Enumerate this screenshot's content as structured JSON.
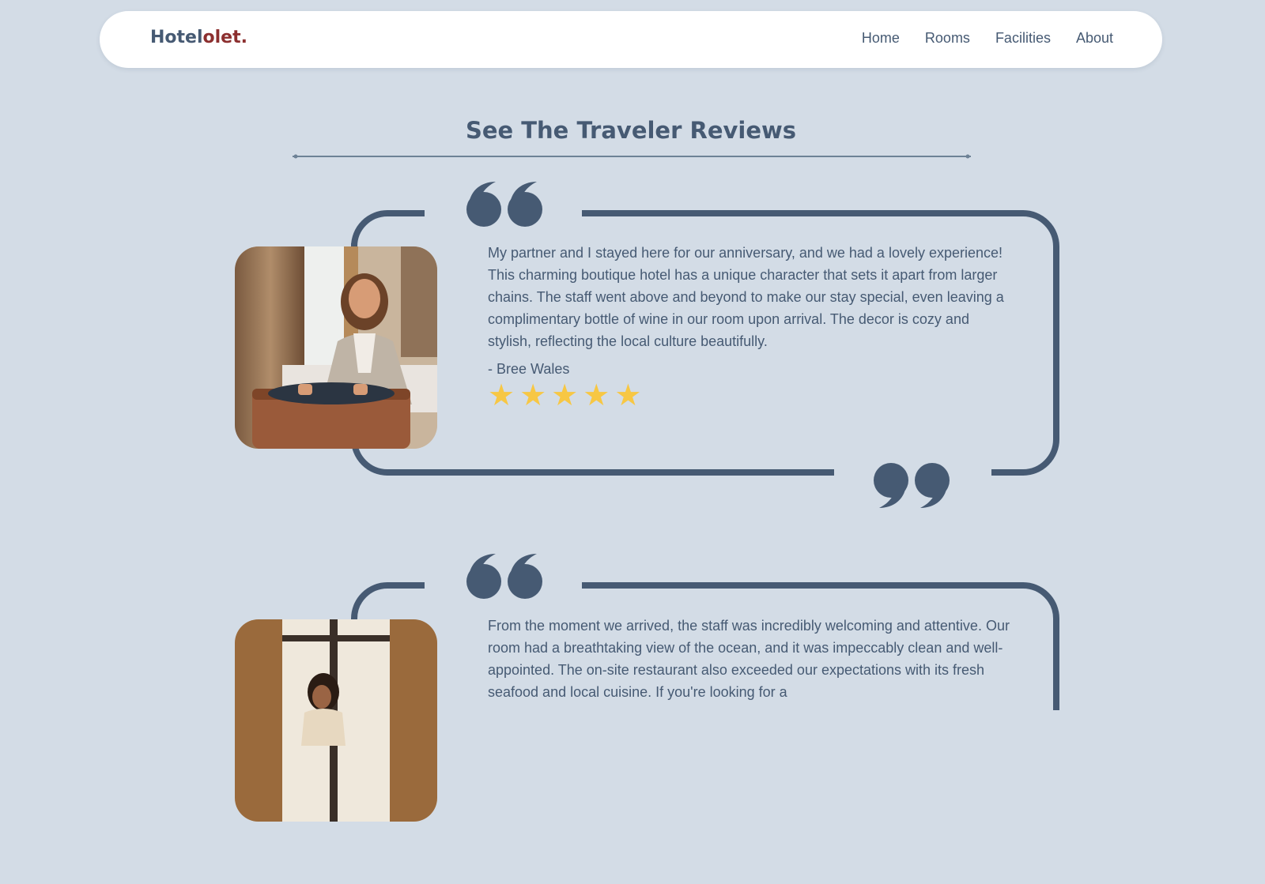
{
  "brand": {
    "part1": "Hotel",
    "part2": "olet",
    "dot": "."
  },
  "nav": {
    "home": "Home",
    "rooms": "Rooms",
    "facilities": "Facilities",
    "about": "About"
  },
  "section": {
    "title": "See The Traveler Reviews"
  },
  "reviews": [
    {
      "text": "My partner and I stayed here for our anniversary, and we had a lovely experience! This charming boutique hotel has a unique character that sets it apart from larger chains. The staff went above and beyond to make our stay special, even leaving a complimentary bottle of wine in our room upon arrival. The decor is cozy and stylish, reflecting the local culture beautifully.",
      "author": "- Bree Wales",
      "rating": 5,
      "star_glyph": "★"
    },
    {
      "text": "From the moment we arrived, the staff was incredibly welcoming and attentive. Our room had a breathtaking view of the ocean, and it was impeccably clean and well-appointed. The on-site restaurant also exceeded our expectations with its fresh seafood and local cuisine. If you're looking for a"
    }
  ],
  "colors": {
    "background": "#d3dce6",
    "primary": "#465a73",
    "brand_accent": "#8c2f2f",
    "star": "#f7c744"
  },
  "icons": {
    "open_quote": "open-quote-icon",
    "close_quote": "close-quote-icon",
    "star": "star-icon"
  }
}
